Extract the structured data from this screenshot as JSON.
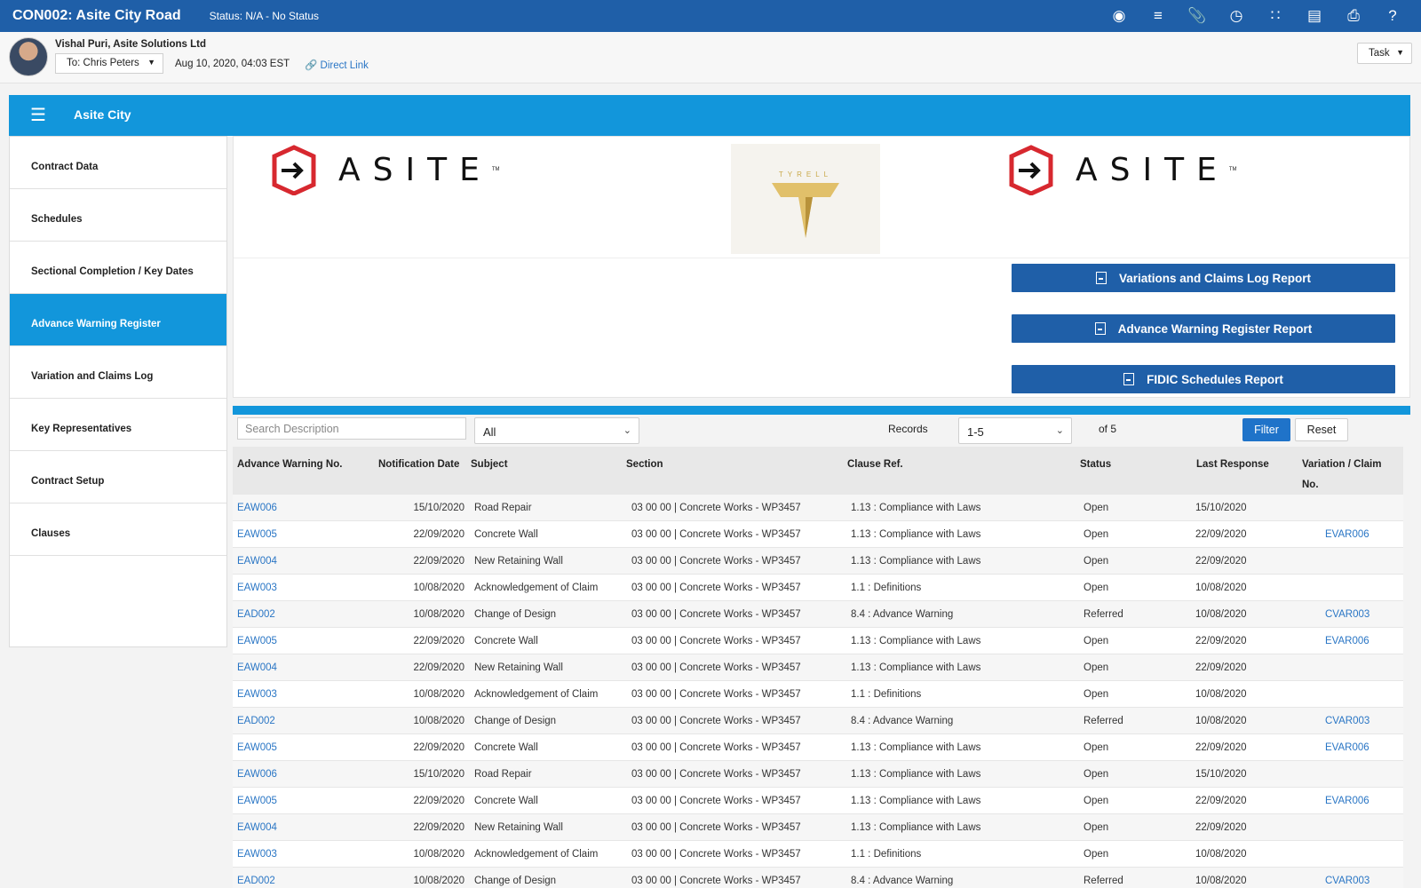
{
  "header": {
    "title": "CON002: Asite City Road",
    "status": "Status: N/A - No Status",
    "icons": [
      "record-icon",
      "list-icon",
      "attachment-icon",
      "history-icon",
      "workflow-icon",
      "document-icon",
      "print-icon",
      "help-icon"
    ]
  },
  "message": {
    "sender": "Vishal Puri, Asite Solutions Ltd",
    "to": "To: Chris Peters",
    "date": "Aug 10, 2020, 04:03 EST",
    "direct_link": "Direct Link",
    "task_label": "Task"
  },
  "app": {
    "title": "Asite City"
  },
  "sidebar": {
    "items": [
      {
        "label": "Contract Data",
        "active": false
      },
      {
        "label": "Schedules",
        "active": false
      },
      {
        "label": "Sectional Completion / Key Dates",
        "active": false
      },
      {
        "label": "Advance Warning Register",
        "active": true
      },
      {
        "label": "Variation and Claims Log",
        "active": false
      },
      {
        "label": "Key Representatives",
        "active": false
      },
      {
        "label": "Contract Setup",
        "active": false
      },
      {
        "label": "Clauses",
        "active": false
      }
    ]
  },
  "logos": {
    "asite_word": "ASITE",
    "asite_tm": "TM",
    "tyrell_word": "TYRELL"
  },
  "reports": {
    "btn1": "Variations and Claims Log Report",
    "btn2": "Advance Warning Register Report",
    "btn3": "FIDIC Schedules Report"
  },
  "filters": {
    "search_placeholder": "Search Description",
    "type_value": "All",
    "records_label": "Records",
    "records_value": "1-5",
    "of_label": "of 5",
    "filter_label": "Filter",
    "reset_label": "Reset"
  },
  "table": {
    "columns": [
      "Advance Warning No.",
      "Notification Date",
      "Subject",
      "Section",
      "Clause Ref.",
      "Status",
      "Last Response",
      "Variation / Claim",
      "No."
    ],
    "rows": [
      [
        "EAW006",
        "15/10/2020",
        "Road Repair",
        "03 00 00 | Concrete Works - WP3457",
        "1.13 : Compliance with Laws",
        "Open",
        "15/10/2020",
        ""
      ],
      [
        "EAW005",
        "22/09/2020",
        "Concrete Wall",
        "03 00 00 | Concrete Works - WP3457",
        "1.13 : Compliance with Laws",
        "Open",
        "22/09/2020",
        "EVAR006"
      ],
      [
        "EAW004",
        "22/09/2020",
        "New Retaining Wall",
        "03 00 00 | Concrete Works - WP3457",
        "1.13 : Compliance with Laws",
        "Open",
        "22/09/2020",
        ""
      ],
      [
        "EAW003",
        "10/08/2020",
        "Acknowledgement of Claim",
        "03 00 00 | Concrete Works - WP3457",
        "1.1 : Definitions",
        "Open",
        "10/08/2020",
        ""
      ],
      [
        "EAD002",
        "10/08/2020",
        "Change of Design",
        "03 00 00 | Concrete Works - WP3457",
        "8.4 : Advance Warning",
        "Referred",
        "10/08/2020",
        "CVAR003"
      ],
      [
        "EAW005",
        "22/09/2020",
        "Concrete Wall",
        "03 00 00 | Concrete Works - WP3457",
        "1.13 : Compliance with Laws",
        "Open",
        "22/09/2020",
        "EVAR006"
      ],
      [
        "EAW004",
        "22/09/2020",
        "New Retaining Wall",
        "03 00 00 | Concrete Works - WP3457",
        "1.13 : Compliance with Laws",
        "Open",
        "22/09/2020",
        ""
      ],
      [
        "EAW003",
        "10/08/2020",
        "Acknowledgement of Claim",
        "03 00 00 | Concrete Works - WP3457",
        "1.1 : Definitions",
        "Open",
        "10/08/2020",
        ""
      ],
      [
        "EAD002",
        "10/08/2020",
        "Change of Design",
        "03 00 00 | Concrete Works - WP3457",
        "8.4 : Advance Warning",
        "Referred",
        "10/08/2020",
        "CVAR003"
      ],
      [
        "EAW005",
        "22/09/2020",
        "Concrete Wall",
        "03 00 00 | Concrete Works - WP3457",
        "1.13 : Compliance with Laws",
        "Open",
        "22/09/2020",
        "EVAR006"
      ],
      [
        "EAW006",
        "15/10/2020",
        "Road Repair",
        "03 00 00 | Concrete Works - WP3457",
        "1.13 : Compliance with Laws",
        "Open",
        "15/10/2020",
        ""
      ],
      [
        "EAW005",
        "22/09/2020",
        "Concrete Wall",
        "03 00 00 | Concrete Works - WP3457",
        "1.13 : Compliance with Laws",
        "Open",
        "22/09/2020",
        "EVAR006"
      ],
      [
        "EAW004",
        "22/09/2020",
        "New Retaining Wall",
        "03 00 00 | Concrete Works - WP3457",
        "1.13 : Compliance with Laws",
        "Open",
        "22/09/2020",
        ""
      ],
      [
        "EAW003",
        "10/08/2020",
        "Acknowledgement of Claim",
        "03 00 00 | Concrete Works - WP3457",
        "1.1 : Definitions",
        "Open",
        "10/08/2020",
        ""
      ],
      [
        "EAD002",
        "10/08/2020",
        "Change of Design",
        "03 00 00 | Concrete Works - WP3457",
        "8.4 : Advance Warning",
        "Referred",
        "10/08/2020",
        "CVAR003"
      ]
    ]
  },
  "colors": {
    "header_blue": "#1f5fa8",
    "accent_blue": "#1296db",
    "link_blue": "#2a76c5",
    "asite_red": "#d7282f",
    "tyrell_gold": "#c9a94a"
  }
}
